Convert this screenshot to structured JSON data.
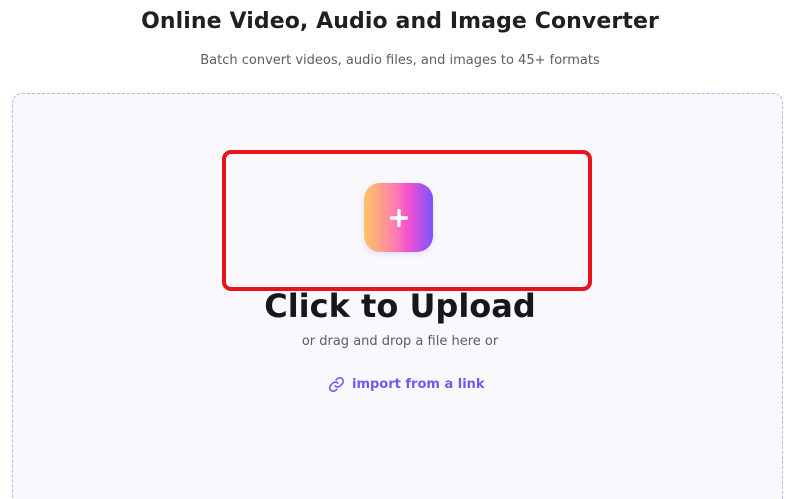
{
  "header": {
    "title": "Online Video, Audio and Image Converter",
    "subtitle": "Batch convert videos, audio files, and images to 45+ formats"
  },
  "upload": {
    "button_icon": "plus-icon",
    "cta_label": "Click to Upload",
    "hint": "or drag and drop a file here or",
    "link_icon": "link-icon",
    "link_label": "import from a link"
  },
  "colors": {
    "accent": "#6a5cf0",
    "highlight": "#e8141c",
    "dropzone_border": "#b9b3ee",
    "dropzone_bg": "#f8f8fd"
  }
}
